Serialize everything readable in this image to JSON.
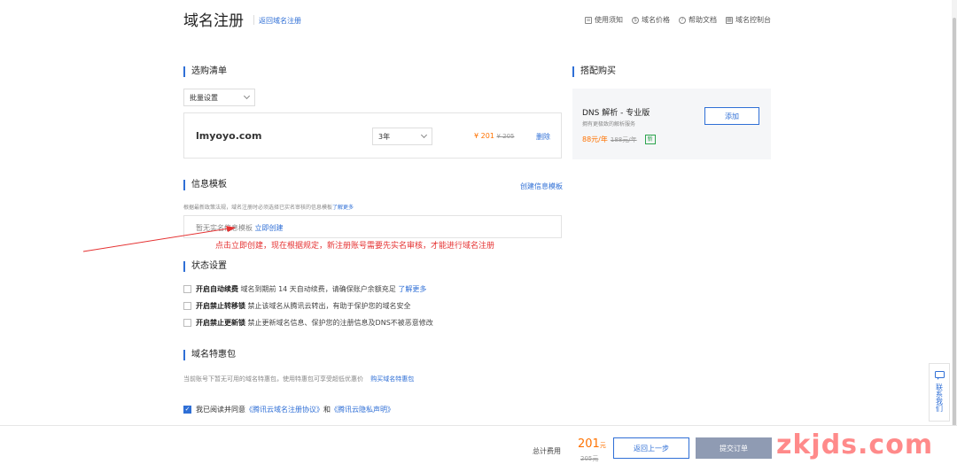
{
  "header": {
    "title": "域名注册",
    "back_link": "返回域名注册",
    "links": [
      "使用须知",
      "域名价格",
      "帮助文档",
      "域名控制台"
    ]
  },
  "cart": {
    "heading": "选购清单",
    "batch_setting": "批量设置",
    "items": [
      {
        "domain": "lmyoyo.com",
        "duration": "3年",
        "price": "¥ 201",
        "original_price": "¥ 205",
        "delete_label": "删除"
      }
    ]
  },
  "addon": {
    "heading": "搭配购买",
    "name": "DNS 解析 - 专业版",
    "desc": "拥有更极致的解析服务",
    "price": "88元/年",
    "original_price": "188元/年",
    "tag": "新",
    "add_label": "添加"
  },
  "info_template": {
    "heading": "信息模板",
    "create_link": "创建信息模板",
    "notice": "根据最新政策法规，域名注册时必须选择已实名审核的信息模板",
    "learn_more": "了解更多",
    "empty_text": "暂无实名信息模板",
    "create_now": "立即创建"
  },
  "annotation": "点击立即创建，现在根据规定，新注册账号需要先实名审核，才能进行域名注册",
  "status": {
    "heading": "状态设置",
    "options": [
      {
        "title": "开启自动续费",
        "desc": "域名到期前 14 天自动续费，请确保账户余额充足",
        "link": "了解更多"
      },
      {
        "title": "开启禁止转移锁",
        "desc": "禁止该域名从腾讯云转出，有助于保护您的域名安全"
      },
      {
        "title": "开启禁止更新锁",
        "desc": "禁止更新域名信息、保护您的注册信息及DNS不被恶意修改"
      }
    ]
  },
  "package": {
    "heading": "域名特惠包",
    "desc": "当前账号下暂无可用的域名特惠包，使用特惠包可享受超低优惠价",
    "buy_link": "购买域名特惠包"
  },
  "agreement": {
    "prefix": "我已阅读并同意",
    "link1": "《腾讯云域名注册协议》",
    "and": "和",
    "link2": "《腾讯云隐私声明》"
  },
  "footer": {
    "total_label": "总计费用",
    "total": "201",
    "unit": "元",
    "original": "205元",
    "prev_label": "返回上一步",
    "submit_label": "提交订单"
  },
  "watermark": "zkjds.com",
  "side_contact": "联系我们",
  "colors": {
    "accent": "#2f6fd6",
    "price": "#ff7200",
    "annotation": "#e53232"
  }
}
